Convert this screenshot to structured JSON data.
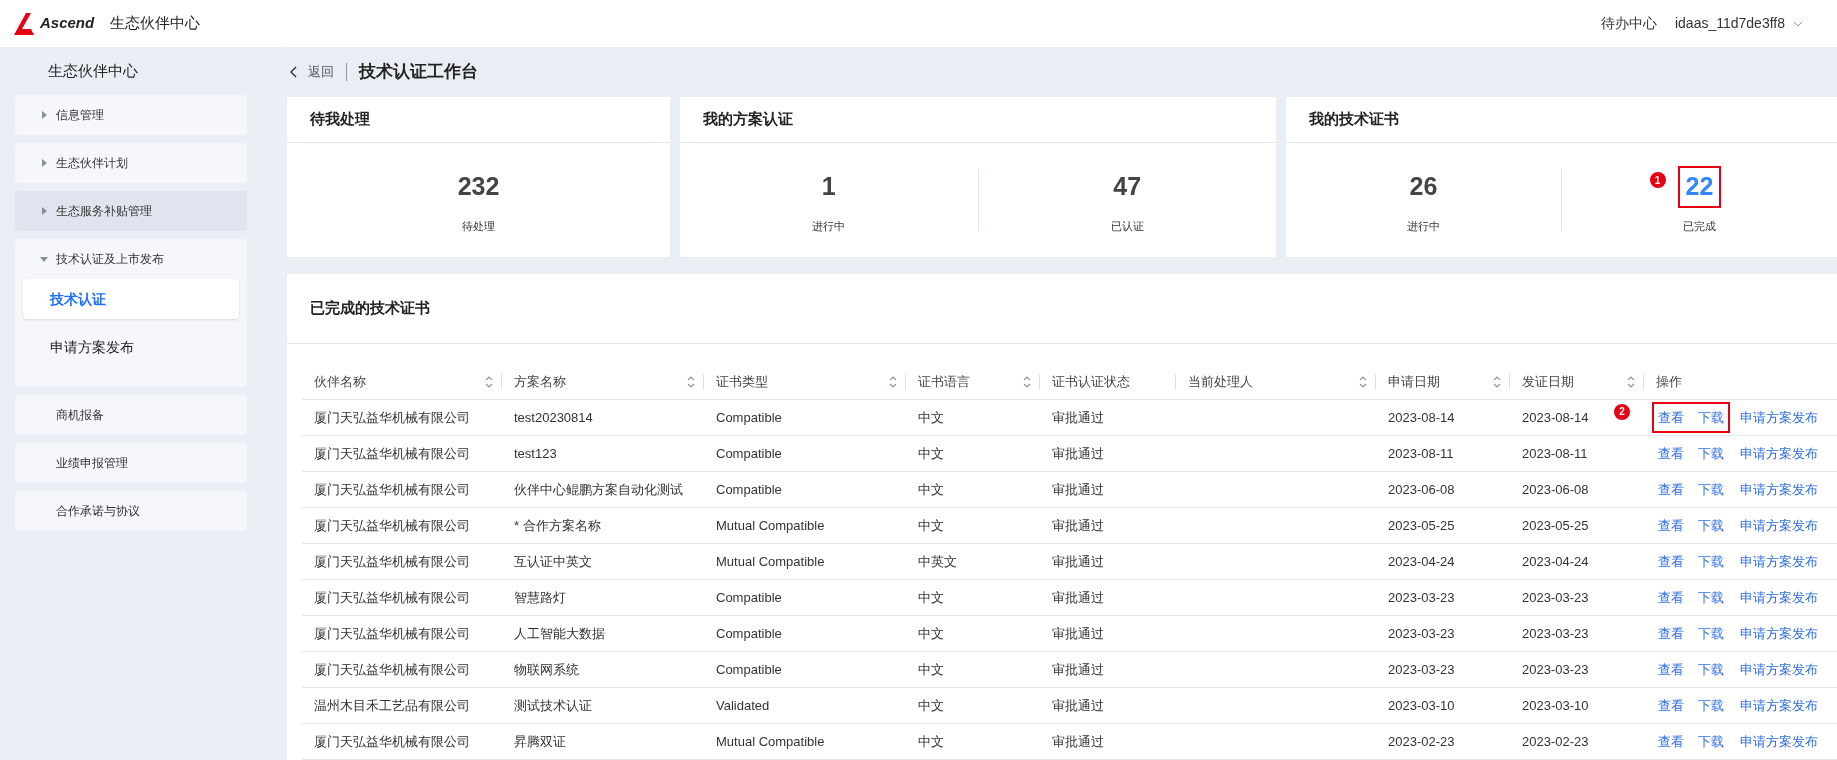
{
  "header": {
    "logo_text": "Ascend",
    "site_title": "生态伙伴中心",
    "todo_link": "待办中心",
    "user": "idaas_11d7de3ff8"
  },
  "sidebar": {
    "title": "生态伙伴中心",
    "items": [
      {
        "label": "信息管理",
        "kind": "group",
        "expanded": false,
        "hovered": false
      },
      {
        "label": "生态伙伴计划",
        "kind": "group",
        "expanded": false,
        "hovered": false
      },
      {
        "label": "生态服务补贴管理",
        "kind": "group",
        "expanded": false,
        "hovered": true
      },
      {
        "label": "技术认证及上市发布",
        "kind": "group",
        "expanded": true,
        "hovered": false,
        "children": [
          {
            "label": "技术认证",
            "selected": true
          },
          {
            "label": "申请方案发布",
            "selected": false
          }
        ]
      },
      {
        "label": "商机报备",
        "kind": "link",
        "hovered": false
      },
      {
        "label": "业绩申报管理",
        "kind": "link",
        "hovered": false
      },
      {
        "label": "合作承诺与协议",
        "kind": "link",
        "hovered": false
      }
    ]
  },
  "breadcrumb": {
    "back": "返回",
    "title": "技术认证工作台"
  },
  "cards": [
    {
      "title": "待我处理",
      "stats": [
        {
          "value": "232",
          "label": "待处理",
          "link": false
        }
      ]
    },
    {
      "title": "我的方案认证",
      "stats": [
        {
          "value": "1",
          "label": "进行中",
          "link": false
        },
        {
          "value": "47",
          "label": "已认证",
          "link": false
        }
      ]
    },
    {
      "title": "我的技术证书",
      "stats": [
        {
          "value": "26",
          "label": "进行中",
          "link": false
        },
        {
          "value": "22",
          "label": "已完成",
          "link": true,
          "annotation": "1"
        }
      ]
    }
  ],
  "table_section": {
    "title": "已完成的技术证书",
    "columns": [
      {
        "label": "伙伴名称",
        "sortable": true
      },
      {
        "label": "方案名称",
        "sortable": true
      },
      {
        "label": "证书类型",
        "sortable": true
      },
      {
        "label": "证书语言",
        "sortable": true
      },
      {
        "label": "证书认证状态",
        "sortable": false
      },
      {
        "label": "当前处理人",
        "sortable": true
      },
      {
        "label": "申请日期",
        "sortable": true
      },
      {
        "label": "发证日期",
        "sortable": true
      },
      {
        "label": "操作",
        "sortable": false
      }
    ],
    "rows": [
      {
        "cells": [
          "厦门天弘益华机械有限公司",
          "test20230814",
          "Compatible",
          "中文",
          "审批通过",
          "",
          "2023-08-14",
          "2023-08-14"
        ],
        "actions": [
          "查看",
          "下载",
          "申请方案发布"
        ],
        "annotation": "2"
      },
      {
        "cells": [
          "厦门天弘益华机械有限公司",
          "test123",
          "Compatible",
          "中文",
          "审批通过",
          "",
          "2023-08-11",
          "2023-08-11"
        ],
        "actions": [
          "查看",
          "下载",
          "申请方案发布"
        ]
      },
      {
        "cells": [
          "厦门天弘益华机械有限公司",
          "伙伴中心鲲鹏方案自动化测试",
          "Compatible",
          "中文",
          "审批通过",
          "",
          "2023-06-08",
          "2023-06-08"
        ],
        "actions": [
          "查看",
          "下载",
          "申请方案发布"
        ]
      },
      {
        "cells": [
          "厦门天弘益华机械有限公司",
          "* 合作方案名称",
          "Mutual Compatible",
          "中文",
          "审批通过",
          "",
          "2023-05-25",
          "2023-05-25"
        ],
        "actions": [
          "查看",
          "下载",
          "申请方案发布"
        ]
      },
      {
        "cells": [
          "厦门天弘益华机械有限公司",
          "互认证中英文",
          "Mutual Compatible",
          "中英文",
          "审批通过",
          "",
          "2023-04-24",
          "2023-04-24"
        ],
        "actions": [
          "查看",
          "下载",
          "申请方案发布"
        ]
      },
      {
        "cells": [
          "厦门天弘益华机械有限公司",
          "智慧路灯",
          "Compatible",
          "中文",
          "审批通过",
          "",
          "2023-03-23",
          "2023-03-23"
        ],
        "actions": [
          "查看",
          "下载",
          "申请方案发布"
        ]
      },
      {
        "cells": [
          "厦门天弘益华机械有限公司",
          "人工智能大数据",
          "Compatible",
          "中文",
          "审批通过",
          "",
          "2023-03-23",
          "2023-03-23"
        ],
        "actions": [
          "查看",
          "下载",
          "申请方案发布"
        ]
      },
      {
        "cells": [
          "厦门天弘益华机械有限公司",
          "物联网系统",
          "Compatible",
          "中文",
          "审批通过",
          "",
          "2023-03-23",
          "2023-03-23"
        ],
        "actions": [
          "查看",
          "下载",
          "申请方案发布"
        ]
      },
      {
        "cells": [
          "温州木目禾工艺品有限公司",
          "测试技术认证",
          "Validated",
          "中文",
          "审批通过",
          "",
          "2023-03-10",
          "2023-03-10"
        ],
        "actions": [
          "查看",
          "下载",
          "申请方案发布"
        ]
      },
      {
        "cells": [
          "厦门天弘益华机械有限公司",
          "昇腾双证",
          "Mutual Compatible",
          "中文",
          "审批通过",
          "",
          "2023-02-23",
          "2023-02-23"
        ],
        "actions": [
          "查看",
          "下载",
          "申请方案发布"
        ]
      }
    ]
  }
}
